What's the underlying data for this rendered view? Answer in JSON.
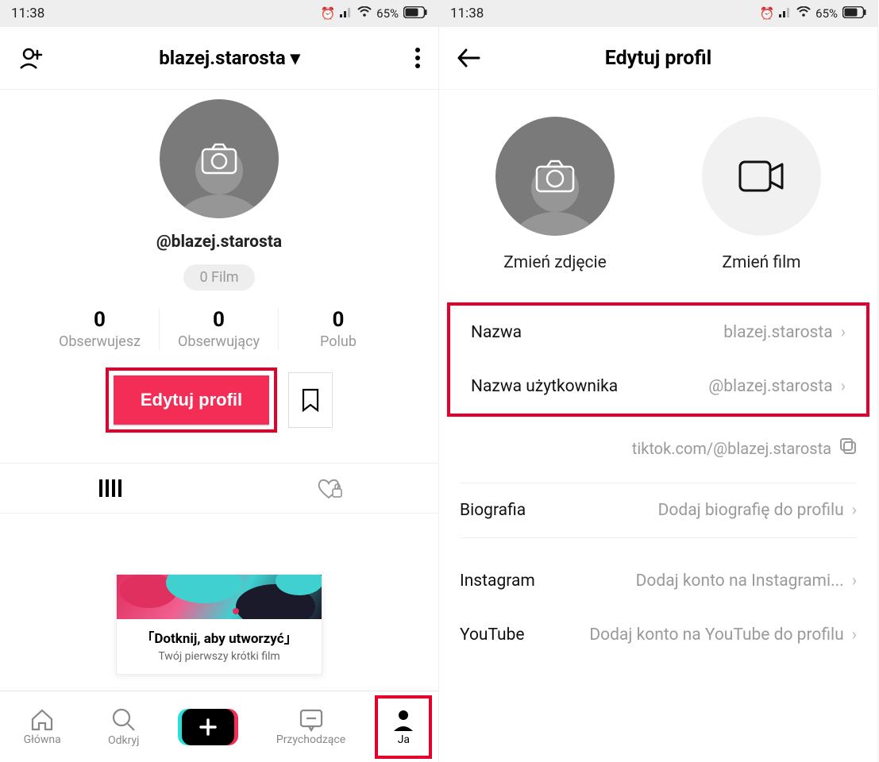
{
  "status": {
    "time": "11:38",
    "battery": "65%"
  },
  "left": {
    "header": {
      "username": "blazej.starosta"
    },
    "handle": "@blazej.starosta",
    "videos_pill": "0 Film",
    "stats": {
      "following": {
        "count": "0",
        "label": "Obserwujesz"
      },
      "followers": {
        "count": "0",
        "label": "Obserwujący"
      },
      "likes": {
        "count": "0",
        "label": "Polub"
      }
    },
    "edit_button": "Edytuj profil",
    "prompt": {
      "title": "「Dotknij, aby utworzyć」",
      "subtitle": "Twój pierwszy krótki film"
    },
    "nav": {
      "home": "Główna",
      "discover": "Odkryj",
      "inbox": "Przychodzące",
      "me": "Ja"
    }
  },
  "right": {
    "title": "Edytuj profil",
    "change_photo": "Zmień zdjęcie",
    "change_video": "Zmień film",
    "rows": {
      "name": {
        "key": "Nazwa",
        "value": "blazej.starosta"
      },
      "username": {
        "key": "Nazwa użytkownika",
        "value": "@blazej.starosta"
      },
      "url": "tiktok.com/@blazej.starosta",
      "bio": {
        "key": "Biografia",
        "value": "Dodaj biografię do profilu"
      },
      "instagram": {
        "key": "Instagram",
        "value": "Dodaj konto na Instagrami..."
      },
      "youtube": {
        "key": "YouTube",
        "value": "Dodaj konto na YouTube do profilu"
      }
    }
  }
}
